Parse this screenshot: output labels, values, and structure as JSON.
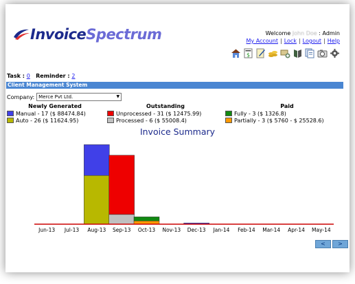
{
  "logo": {
    "part1": "Invoice",
    "part2": "Spectrum"
  },
  "header": {
    "welcome_prefix": "Welcome",
    "user_name": "John Doe",
    "welcome_suffix": ": Admin",
    "links": [
      "My Account",
      "Lock",
      "Logout",
      "Help"
    ]
  },
  "toolbar": {
    "icons": [
      "home-icon",
      "invoice-icon",
      "notepad-icon",
      "coins-icon",
      "money-add-icon",
      "book-icon",
      "documents-icon",
      "camera-icon",
      "settings-icon"
    ]
  },
  "tasks": {
    "task_label": "Task :",
    "task_count": "0",
    "reminder_label": "Reminder :",
    "reminder_count": "2"
  },
  "section": {
    "title": "Client Management System"
  },
  "company": {
    "label": "Company:",
    "selected": "Merce Pvt Ltd."
  },
  "legend": {
    "newly_generated": {
      "heading": "Newly Generated",
      "items": [
        {
          "label": "Manual - 17 ($ 88474.84)",
          "color": "#4040e8"
        },
        {
          "label": "Auto - 26 ($ 11624.95)",
          "color": "#b8b800"
        }
      ]
    },
    "outstanding": {
      "heading": "Outstanding",
      "items": [
        {
          "label": "Unprocessed - 31 ($ 12475.99)",
          "color": "#ee0000"
        },
        {
          "label": "Processed - 6 ($ 55008.4)",
          "color": "#c0c0c0"
        }
      ]
    },
    "paid": {
      "heading": "Paid",
      "items": [
        {
          "label": "Fully - 3 ($ 1326.8)",
          "color": "#118a11"
        },
        {
          "label": "Partially - 3 ($ 5760 - $ 25528.6)",
          "color": "#ff9900"
        }
      ]
    }
  },
  "chart_data": {
    "type": "bar",
    "title": "Invoice Summary",
    "categories": [
      "Jun-13",
      "Jul-13",
      "Aug-13",
      "Sep-13",
      "Oct-13",
      "Nov-13",
      "Dec-13",
      "Jan-14",
      "Feb-14",
      "Mar-14",
      "Apr-14",
      "May-14"
    ],
    "ylim": [
      0,
      100
    ],
    "stacked": true,
    "series": [
      {
        "color": "#b8b800",
        "values": [
          0,
          0,
          60,
          0,
          0,
          0,
          0,
          0,
          0,
          0,
          0,
          0
        ]
      },
      {
        "color": "#4040e8",
        "values": [
          0,
          0,
          38,
          0,
          0,
          0,
          1.5,
          0,
          0,
          0,
          0,
          0
        ]
      },
      {
        "color": "#c0c0c0",
        "values": [
          0,
          0,
          0,
          12,
          0,
          0,
          0,
          0,
          0,
          0,
          0,
          0
        ]
      },
      {
        "color": "#ee0000",
        "values": [
          0,
          0,
          0,
          73,
          0,
          0,
          0,
          0,
          0,
          0,
          0,
          0
        ]
      },
      {
        "color": "#ff9900",
        "values": [
          0,
          0,
          0,
          0,
          4,
          0,
          0,
          0,
          0,
          0,
          0,
          0
        ]
      },
      {
        "color": "#118a11",
        "values": [
          0,
          0,
          0,
          0,
          5,
          0,
          0,
          0,
          0,
          0,
          0,
          0
        ]
      }
    ],
    "grid": false,
    "xlabel": "",
    "ylabel": ""
  },
  "pager": {
    "prev": "<",
    "next": ">"
  }
}
